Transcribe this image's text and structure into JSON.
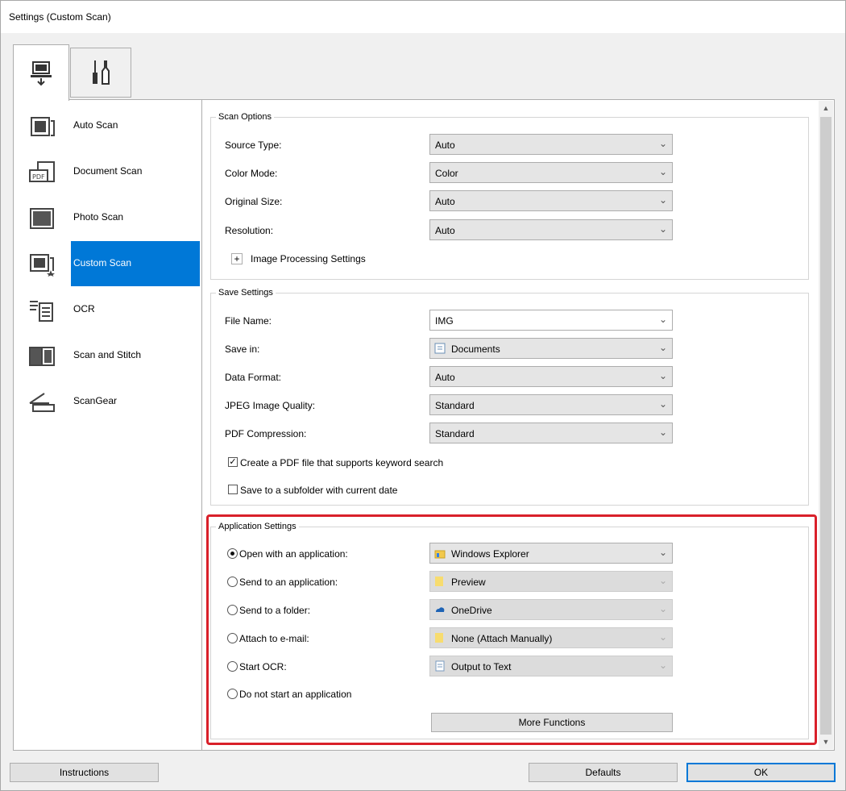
{
  "window": {
    "title": "Settings (Custom Scan)"
  },
  "tabs": [
    {
      "icon": "scan-from-computer-icon",
      "selected": true
    },
    {
      "icon": "general-settings-tools-icon",
      "selected": false
    }
  ],
  "scan_list": [
    {
      "label": "Auto Scan",
      "icon": "auto-scan-icon",
      "selected": false
    },
    {
      "label": "Document Scan",
      "icon": "document-scan-icon",
      "selected": false
    },
    {
      "label": "Photo Scan",
      "icon": "photo-scan-icon",
      "selected": false
    },
    {
      "label": "Custom Scan",
      "icon": "custom-scan-icon",
      "selected": true
    },
    {
      "label": "OCR",
      "icon": "ocr-icon",
      "selected": false
    },
    {
      "label": "Scan and Stitch",
      "icon": "scan-and-stitch-icon",
      "selected": false
    },
    {
      "label": "ScanGear",
      "icon": "scangear-icon",
      "selected": false
    }
  ],
  "scan_options": {
    "legend": "Scan Options",
    "source_type": {
      "label": "Source Type:",
      "value": "Auto"
    },
    "color_mode": {
      "label": "Color Mode:",
      "value": "Color"
    },
    "original_size": {
      "label": "Original Size:",
      "value": "Auto"
    },
    "resolution": {
      "label": "Resolution:",
      "value": "Auto"
    },
    "image_processing": {
      "expand": "+",
      "label": "Image Processing Settings"
    }
  },
  "save_settings": {
    "legend": "Save Settings",
    "file_name": {
      "label": "File Name:",
      "value": "IMG"
    },
    "save_in": {
      "label": "Save in:",
      "value": "Documents"
    },
    "data_format": {
      "label": "Data Format:",
      "value": "Auto"
    },
    "jpeg_quality": {
      "label": "JPEG Image Quality:",
      "value": "Standard"
    },
    "pdf_compression": {
      "label": "PDF Compression:",
      "value": "Standard"
    },
    "keyword_pdf": {
      "label": "Create a PDF file that supports keyword search",
      "checked": true
    },
    "subfolder": {
      "label": "Save to a subfolder with current date",
      "checked": false
    }
  },
  "app_settings": {
    "legend": "Application Settings",
    "open_with": {
      "label": "Open with an application:",
      "value": "Windows Explorer",
      "selected": true,
      "enabled": true
    },
    "send_to_app": {
      "label": "Send to an application:",
      "value": "Preview",
      "selected": false,
      "enabled": false
    },
    "send_to_folder": {
      "label": "Send to a folder:",
      "value": "OneDrive",
      "selected": false,
      "enabled": false
    },
    "attach_email": {
      "label": "Attach to e-mail:",
      "value": "None (Attach Manually)",
      "selected": false,
      "enabled": false
    },
    "start_ocr": {
      "label": "Start OCR:",
      "value": "Output to Text",
      "selected": false,
      "enabled": false
    },
    "no_app": {
      "label": "Do not start an application",
      "selected": false
    },
    "more_functions": "More Functions"
  },
  "footer": {
    "instructions": "Instructions",
    "defaults": "Defaults",
    "ok": "OK"
  },
  "colors": {
    "selection": "#0078d7",
    "highlight_box": "#d9202a"
  }
}
